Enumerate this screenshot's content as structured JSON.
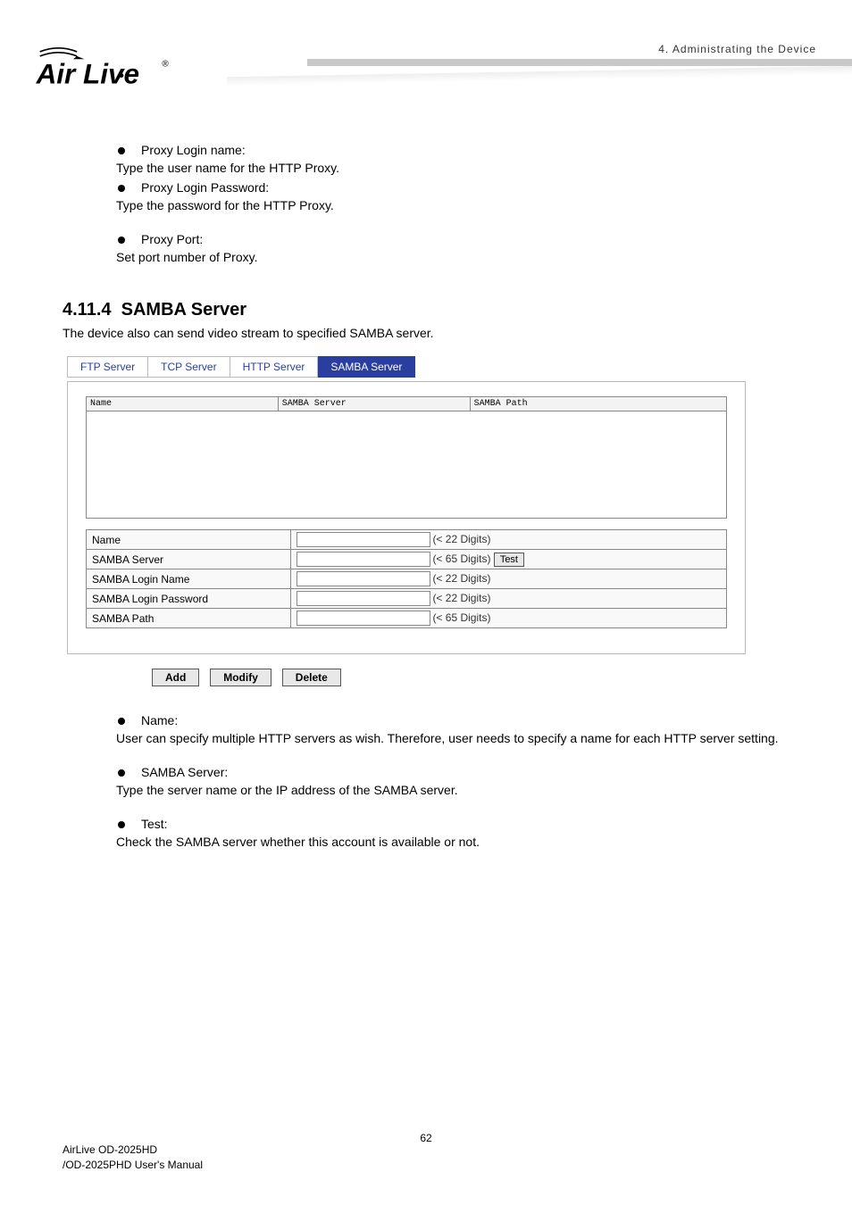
{
  "header": {
    "crumb": "4.  Administrating  the  Device"
  },
  "logo": {
    "name": "Air Live",
    "reg": "®"
  },
  "bullets_top": [
    {
      "label": "Proxy Login name:",
      "desc": "Type the user name for the HTTP Proxy."
    },
    {
      "label": "Proxy Login Password:",
      "desc": "Type the password for the HTTP Proxy."
    },
    {
      "label": "Proxy Port:",
      "desc": "Set port number of Proxy."
    }
  ],
  "section": {
    "num": "4.11.4",
    "title": "SAMBA Server",
    "desc": "The device also can send video stream to specified SAMBA server."
  },
  "tabs": [
    "FTP Server",
    "TCP Server",
    "HTTP Server",
    "SAMBA Server"
  ],
  "listhead": [
    "Name",
    "SAMBA Server",
    "SAMBA Path"
  ],
  "form": {
    "rows": [
      {
        "label": "Name",
        "hint": "(< 22 Digits)",
        "test": false
      },
      {
        "label": "SAMBA Server",
        "hint": "(< 65 Digits)",
        "test": true
      },
      {
        "label": "SAMBA Login Name",
        "hint": "(< 22 Digits)",
        "test": false
      },
      {
        "label": "SAMBA Login Password",
        "hint": "(< 22 Digits)",
        "test": false
      },
      {
        "label": "SAMBA Path",
        "hint": "(< 65 Digits)",
        "test": false
      }
    ],
    "test_label": "Test"
  },
  "buttons": {
    "add": "Add",
    "modify": "Modify",
    "delete": "Delete"
  },
  "bullets_bottom": [
    {
      "label": "Name:",
      "desc": "User can specify multiple HTTP servers as wish. Therefore, user needs to specify a name for each HTTP server setting."
    },
    {
      "label": "SAMBA Server:",
      "desc": "Type the server name or the IP address of the SAMBA server."
    },
    {
      "label": "Test:",
      "desc": "Check the SAMBA server whether this account is available or not."
    }
  ],
  "footer": {
    "line1": "AirLive OD-2025HD",
    "line2": "/OD-2025PHD User's Manual",
    "page": "62"
  }
}
